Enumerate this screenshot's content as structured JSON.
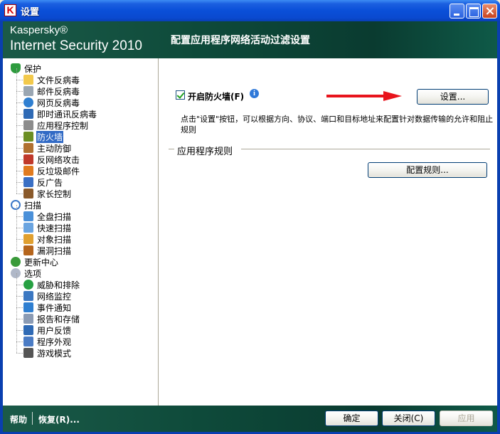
{
  "window": {
    "title": "设置",
    "app_icon_letter": "K"
  },
  "header": {
    "brand_line1": "Kaspersky®",
    "brand_line2": "Internet Security 2010",
    "title": "配置应用程序网络活动过滤设置"
  },
  "sidebar": {
    "items": [
      {
        "label": "保护",
        "level": 0,
        "icon": "shield-icon",
        "color": "#2e9b3e"
      },
      {
        "label": "文件反病毒",
        "level": 1,
        "icon": "folder-icon",
        "color": "#f2c94c"
      },
      {
        "label": "邮件反病毒",
        "level": 1,
        "icon": "mail-icon",
        "color": "#9aa6b2"
      },
      {
        "label": "网页反病毒",
        "level": 1,
        "icon": "globe-icon",
        "color": "#2f7fd1"
      },
      {
        "label": "即时通讯反病毒",
        "level": 1,
        "icon": "chat-icon",
        "color": "#2f6ab5"
      },
      {
        "label": "应用程序控制",
        "level": 1,
        "icon": "filter-icon",
        "color": "#8c8c8c"
      },
      {
        "label": "防火墙",
        "level": 1,
        "icon": "firewall-icon",
        "color": "#6b8e23",
        "selected": true
      },
      {
        "label": "主动防御",
        "level": 1,
        "icon": "defense-icon",
        "color": "#b07030"
      },
      {
        "label": "反网络攻击",
        "level": 1,
        "icon": "network-attack-icon",
        "color": "#c0392b"
      },
      {
        "label": "反垃圾邮件",
        "level": 1,
        "icon": "antispam-icon",
        "color": "#e07b20"
      },
      {
        "label": "反广告",
        "level": 1,
        "icon": "antibanner-icon",
        "color": "#3a6fc4"
      },
      {
        "label": "家长控制",
        "level": 1,
        "icon": "parental-icon",
        "color": "#8a5a2b"
      },
      {
        "label": "扫描",
        "level": 0,
        "icon": "magnifier-icon",
        "color": "#3c78c8"
      },
      {
        "label": "全盘扫描",
        "level": 1,
        "icon": "full-scan-icon",
        "color": "#4a90d9"
      },
      {
        "label": "快速扫描",
        "level": 1,
        "icon": "quick-scan-icon",
        "color": "#6aa4e0"
      },
      {
        "label": "对象扫描",
        "level": 1,
        "icon": "object-scan-icon",
        "color": "#e0a030"
      },
      {
        "label": "漏洞扫描",
        "level": 1,
        "icon": "vulnerability-scan-icon",
        "color": "#b5651d"
      },
      {
        "label": "更新中心",
        "level": 0,
        "icon": "update-icon",
        "color": "#3a9a3a"
      },
      {
        "label": "选项",
        "level": 0,
        "icon": "options-icon",
        "color": "#b0b8c8"
      },
      {
        "label": "威胁和排除",
        "level": 1,
        "icon": "threats-icon",
        "color": "#27a042"
      },
      {
        "label": "网络监控",
        "level": 1,
        "icon": "network-monitor-icon",
        "color": "#3b78c2"
      },
      {
        "label": "事件通知",
        "level": 1,
        "icon": "notification-icon",
        "color": "#2f7fd1"
      },
      {
        "label": "报告和存储",
        "level": 1,
        "icon": "reports-icon",
        "color": "#8b9bb4"
      },
      {
        "label": "用户反馈",
        "level": 1,
        "icon": "feedback-icon",
        "color": "#2f6ab5"
      },
      {
        "label": "程序外观",
        "level": 1,
        "icon": "appearance-icon",
        "color": "#4a7bc4"
      },
      {
        "label": "游戏模式",
        "level": 1,
        "icon": "gamepad-icon",
        "color": "#555555"
      }
    ]
  },
  "main": {
    "firewall_checkbox": {
      "label": "开启防火墙(F)",
      "checked": true
    },
    "settings_button": "设置...",
    "description": "点击\"设置\"按钮，可以根据方向、协议、端口和目标地址来配置针对数据传输的允许和阻止规则",
    "section_title": "应用程序规则",
    "configure_rules_button": "配置规则..."
  },
  "footer": {
    "help_label": "帮助",
    "restore_label": "恢复(R)...",
    "ok_label": "确定",
    "close_label": "关闭(C)",
    "apply_label": "应用"
  }
}
